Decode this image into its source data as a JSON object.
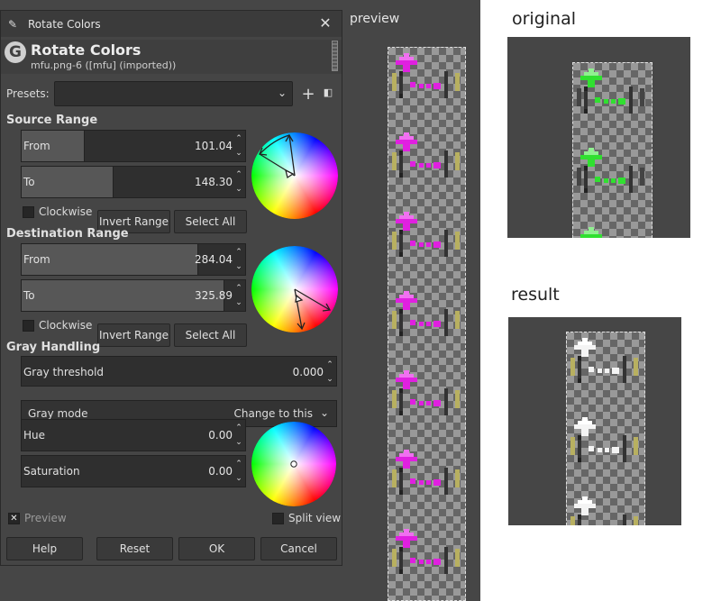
{
  "canvas": {
    "preview_label": "preview"
  },
  "side": {
    "original_label": "original",
    "result_label": "result"
  },
  "dialog": {
    "window_title": "Rotate Colors",
    "header_title": "Rotate Colors",
    "header_subtitle": "mfu.png-6 ([mfu] (imported))",
    "presets_label": "Presets:",
    "presets_value": "",
    "source_range": {
      "heading": "Source Range",
      "from_label": "From",
      "from_value": "101.04",
      "from_fraction": 0.2807,
      "to_label": "To",
      "to_value": "148.30",
      "to_fraction": 0.4119,
      "clockwise_label": "Clockwise",
      "invert_label": "Invert Range",
      "select_all_label": "Select All"
    },
    "destination_range": {
      "heading": "Destination Range",
      "from_label": "From",
      "from_value": "284.04",
      "from_fraction": 0.789,
      "to_label": "To",
      "to_value": "325.89",
      "to_fraction": 0.9053,
      "clockwise_label": "Clockwise",
      "invert_label": "Invert Range",
      "select_all_label": "Select All"
    },
    "gray_handling": {
      "heading": "Gray Handling",
      "threshold_label": "Gray threshold",
      "threshold_value": "0.000",
      "mode_label": "Gray mode",
      "mode_value": "Change to this",
      "hue_label": "Hue",
      "hue_value": "0.00",
      "saturation_label": "Saturation",
      "saturation_value": "0.00"
    },
    "preview_label": "Preview",
    "split_view_label": "Split view",
    "buttons": {
      "help": "Help",
      "reset": "Reset",
      "ok": "OK",
      "cancel": "Cancel"
    }
  },
  "colors": {
    "magenta": "#e020e0",
    "pink": "#f070f0",
    "green": "#30e030",
    "light_green": "#90f090",
    "olive": "#b8b060",
    "white": "#f4f4f4"
  }
}
